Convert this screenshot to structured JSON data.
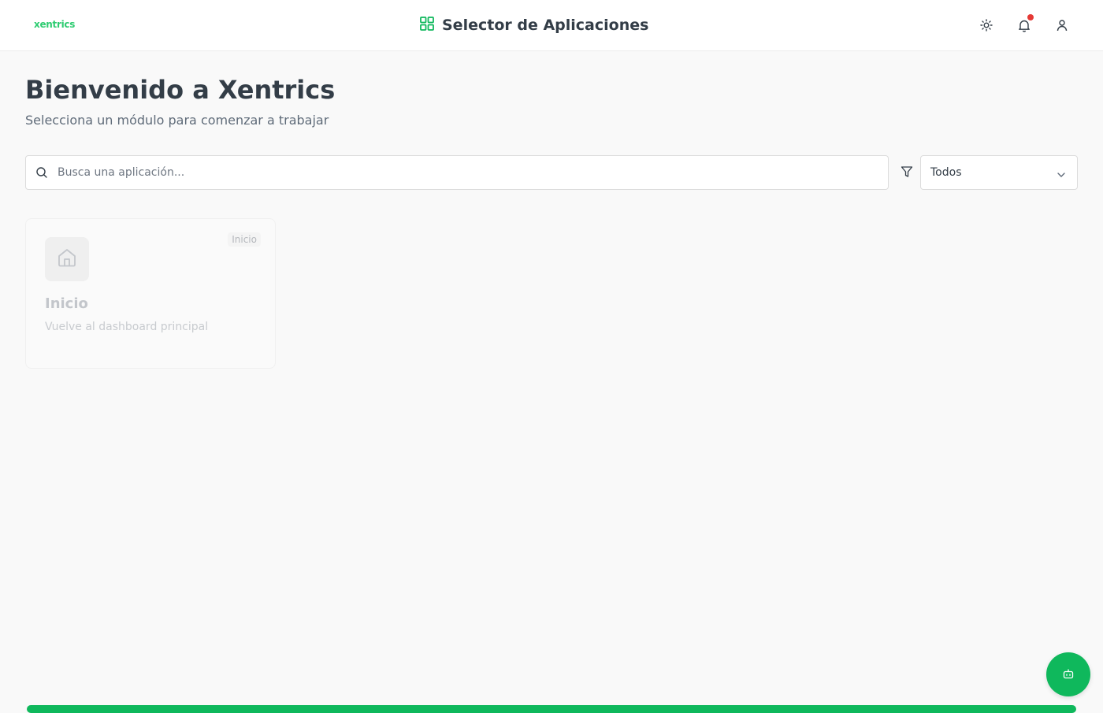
{
  "colors": {
    "accent": "#0fb85c",
    "logo": "#2ecc71",
    "notification_dot": "#e53935",
    "text_primary": "#333d47",
    "text_muted": "#5f6b79"
  },
  "header": {
    "logo_text": "xentrics",
    "title": "Selector de Aplicaciones",
    "title_icon": "grid-icon",
    "icons": [
      "sun-icon",
      "bell-icon",
      "user-icon"
    ]
  },
  "hero": {
    "title": "Bienvenido a Xentrics",
    "subtitle": "Selecciona un módulo para comenzar a trabajar"
  },
  "search": {
    "placeholder": "Busca una aplicación...",
    "value": ""
  },
  "filter": {
    "selected": "Todos"
  },
  "apps": [
    {
      "badge": "Inicio",
      "title": "Inicio",
      "description": "Vuelve al dashboard principal",
      "icon": "home-icon"
    }
  ],
  "fab": {
    "icon": "bot-icon"
  }
}
